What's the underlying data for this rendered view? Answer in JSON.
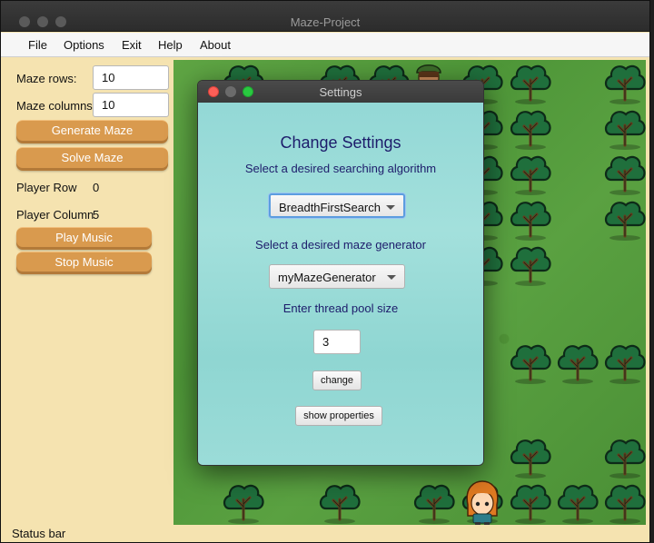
{
  "window": {
    "title": "Maze-Project"
  },
  "menu": {
    "items": [
      "File",
      "Options",
      "Exit",
      "Help",
      "About"
    ]
  },
  "left_panel": {
    "maze_rows_label": "Maze rows:",
    "maze_rows_value": "10",
    "maze_columns_label": "Maze columns:",
    "maze_columns_value": "10",
    "generate_button": "Generate Maze",
    "solve_button": "Solve Maze",
    "player_row_label": "Player Row",
    "player_row_value": "0",
    "player_column_label": "Player Column",
    "player_column_value": "5",
    "play_music_button": "Play Music",
    "stop_music_button": "Stop Music"
  },
  "status_bar": "Status bar",
  "dialog": {
    "title": "Settings",
    "heading": "Change Settings",
    "search_prompt": "Select a desired  searching algorithm",
    "search_selected": "BreadthFirstSearch",
    "generator_prompt": "Select a desired maze generator",
    "generator_selected": "myMazeGenerator",
    "pool_prompt": "Enter thread  pool size",
    "pool_value": "3",
    "change_button": "change",
    "show_properties_button": "show properties"
  },
  "colors": {
    "button_orange": "#d99a4e",
    "panel_bg": "#f5e3b0",
    "dialog_bg": "#9bdcd8",
    "dialog_text": "#1d1c6b",
    "grass": "#55a03e"
  }
}
